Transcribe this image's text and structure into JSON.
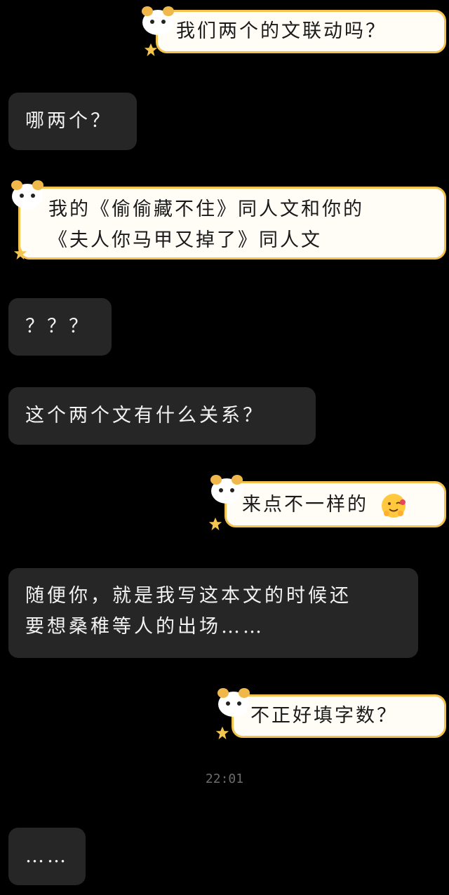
{
  "messages": [
    {
      "side": "right",
      "text": "我们两个的文联动吗？"
    },
    {
      "side": "left",
      "text": "哪两个？"
    },
    {
      "side": "right",
      "line1": "我的《偷偷藏不住》同人文和你的",
      "line2": "《夫人你马甲又掉了》同人文"
    },
    {
      "side": "left",
      "text": "？？？"
    },
    {
      "side": "left",
      "text": "这个两个文有什么关系？"
    },
    {
      "side": "right",
      "text": "来点不一样的",
      "emoji": "hugging-face-emoji"
    },
    {
      "side": "left",
      "line1": "随便你，就是我写这本文的时候还",
      "line2": "要想桑稚等人的出场……"
    },
    {
      "side": "right",
      "text": "不正好填字数？"
    },
    {
      "side": "left",
      "text": "……"
    }
  ],
  "timestamp": "22:01",
  "colors": {
    "background": "#000000",
    "left_bubble": "#262626",
    "right_bubble": "#fffdf6",
    "right_border": "#f3c24f"
  }
}
